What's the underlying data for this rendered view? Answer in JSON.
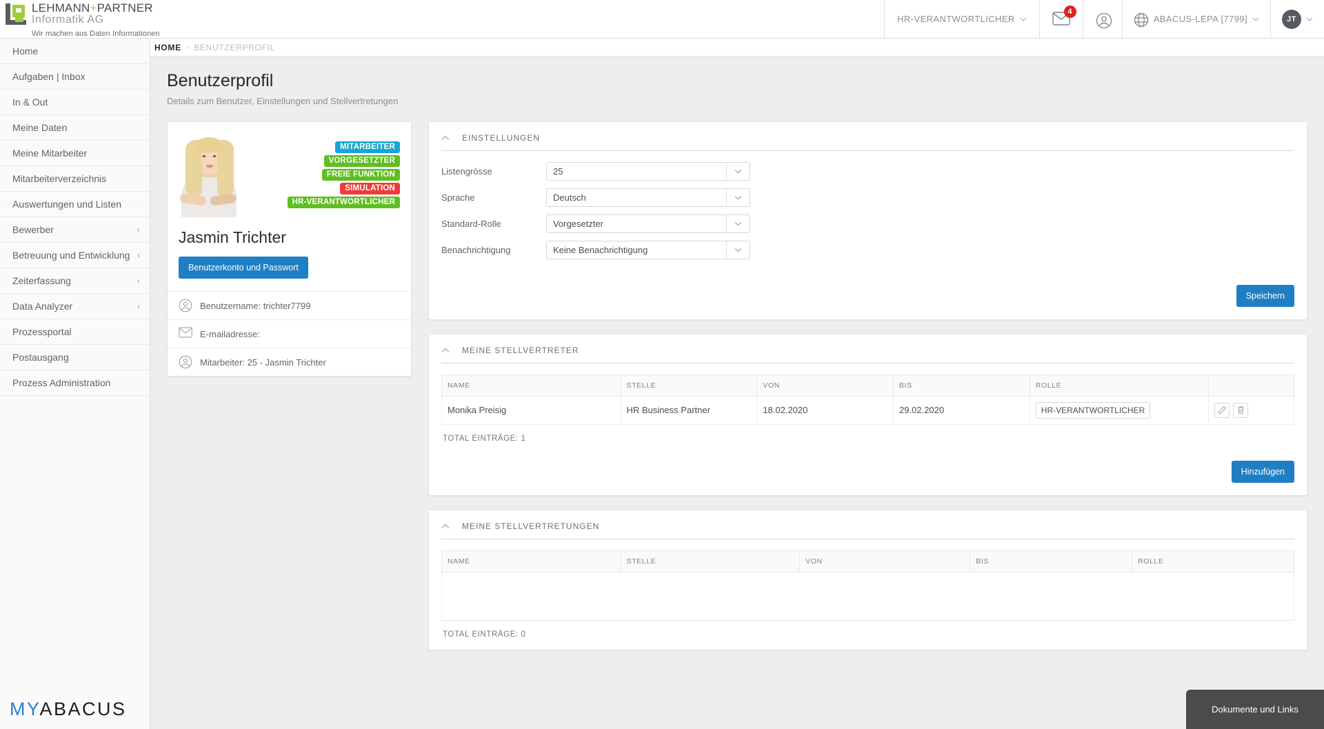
{
  "header": {
    "brand": {
      "line1_a": "LEHMANN",
      "line1_plus": "+",
      "line1_b": "PARTNER",
      "line2": "Informatik AG",
      "tagline": "Wir machen aus Daten Informationen",
      "logo_icon": "lehmann-partner-logo"
    },
    "role_selector": "HR-VERANTWORTLICHER",
    "mail_icon": "envelope-icon",
    "mail_badge": "4",
    "user_icon": "user-circle-icon",
    "globe_icon": "globe-icon",
    "tenant": "ABACUS-LEPA [7799]",
    "avatar_initials": "JT",
    "caret": "⌄"
  },
  "sidebar": {
    "items": [
      {
        "label": "Home",
        "expandable": false
      },
      {
        "label": "Aufgaben | Inbox",
        "expandable": false
      },
      {
        "label": "In & Out",
        "expandable": false
      },
      {
        "label": "Meine Daten",
        "expandable": false
      },
      {
        "label": "Meine Mitarbeiter",
        "expandable": false
      },
      {
        "label": "Mitarbeiterverzeichnis",
        "expandable": false
      },
      {
        "label": "Auswertungen und Listen",
        "expandable": false
      },
      {
        "label": "Bewerber",
        "expandable": true
      },
      {
        "label": "Betreuung und Entwicklung",
        "expandable": true
      },
      {
        "label": "Zeiterfassung",
        "expandable": true
      },
      {
        "label": "Data Analyzer",
        "expandable": true
      },
      {
        "label": "Prozessportal",
        "expandable": false
      },
      {
        "label": "Postausgang",
        "expandable": false
      },
      {
        "label": "Prozess Administration",
        "expandable": false
      }
    ],
    "chevron": "‹",
    "footer_logo": {
      "my": "MY",
      "abacus": "ABACUS"
    }
  },
  "breadcrumb": {
    "home": "HOME",
    "separator": "›",
    "current": "BENUTZERPROFIL"
  },
  "page": {
    "title": "Benutzerprofil",
    "subtitle": "Details zum Benutzer, Einstellungen und Stellvertretungen"
  },
  "profile": {
    "photo_icon": "user-photo",
    "badges": [
      {
        "label": "MITARBEITER",
        "color": "#17a6d4"
      },
      {
        "label": "VORGESETZTER",
        "color": "#5fbe21"
      },
      {
        "label": "FREIE FUNKTION",
        "color": "#5fbe21"
      },
      {
        "label": "SIMULATION",
        "color": "#ef3b3b"
      },
      {
        "label": "HR-VERANTWORTLICHER",
        "color": "#5fbe21"
      }
    ],
    "name": "Jasmin Trichter",
    "account_button": "Benutzerkonto und Passwort",
    "info": [
      {
        "icon": "user-circle-icon",
        "text": "Benutzername: trichter7799"
      },
      {
        "icon": "envelope-icon",
        "text": "E-mailadresse:"
      },
      {
        "icon": "user-circle-icon",
        "text": "Mitarbeiter: 25 - Jasmin Trichter"
      }
    ]
  },
  "settings_panel": {
    "collapse_icon": "chevron-up-icon",
    "title": "EINSTELLUNGEN",
    "fields": [
      {
        "label": "Listengrösse",
        "value": "25"
      },
      {
        "label": "Sprache",
        "value": "Deutsch"
      },
      {
        "label": "Standard-Rolle",
        "value": "Vorgesetzter"
      },
      {
        "label": "Benachrichtigung",
        "value": "Keine Benachrichtigung"
      }
    ],
    "save_button": "Speichern"
  },
  "deputies_panel": {
    "collapse_icon": "chevron-up-icon",
    "title": "MEINE STELLVERTRETER",
    "columns": [
      "NAME",
      "STELLE",
      "VON",
      "BIS",
      "ROLLE",
      ""
    ],
    "rows": [
      {
        "name": "Monika Preisig",
        "stelle": "HR Business Partner",
        "von": "18.02.2020",
        "bis": "29.02.2020",
        "rolle": "HR-VERANTWORTLICHER",
        "edit_icon": "pencil-icon",
        "delete_icon": "trash-icon"
      }
    ],
    "total": "TOTAL EINTRÄGE: 1",
    "add_button": "Hinzufügen"
  },
  "representations_panel": {
    "collapse_icon": "chevron-up-icon",
    "title": "MEINE STELLVERTRETUNGEN",
    "columns": [
      "NAME",
      "STELLE",
      "VON",
      "BIS",
      "ROLLE"
    ],
    "rows": [],
    "total": "TOTAL EINTRÄGE: 0"
  },
  "footer": {
    "documents_button": "Dokumente und Links"
  },
  "colors": {
    "accent_blue": "#1f7fc4",
    "badge_green": "#5fbe21",
    "badge_cyan": "#17a6d4",
    "badge_red": "#ef3b3b",
    "brand_green": "#9fcc3b",
    "notify_red": "#e02020"
  }
}
